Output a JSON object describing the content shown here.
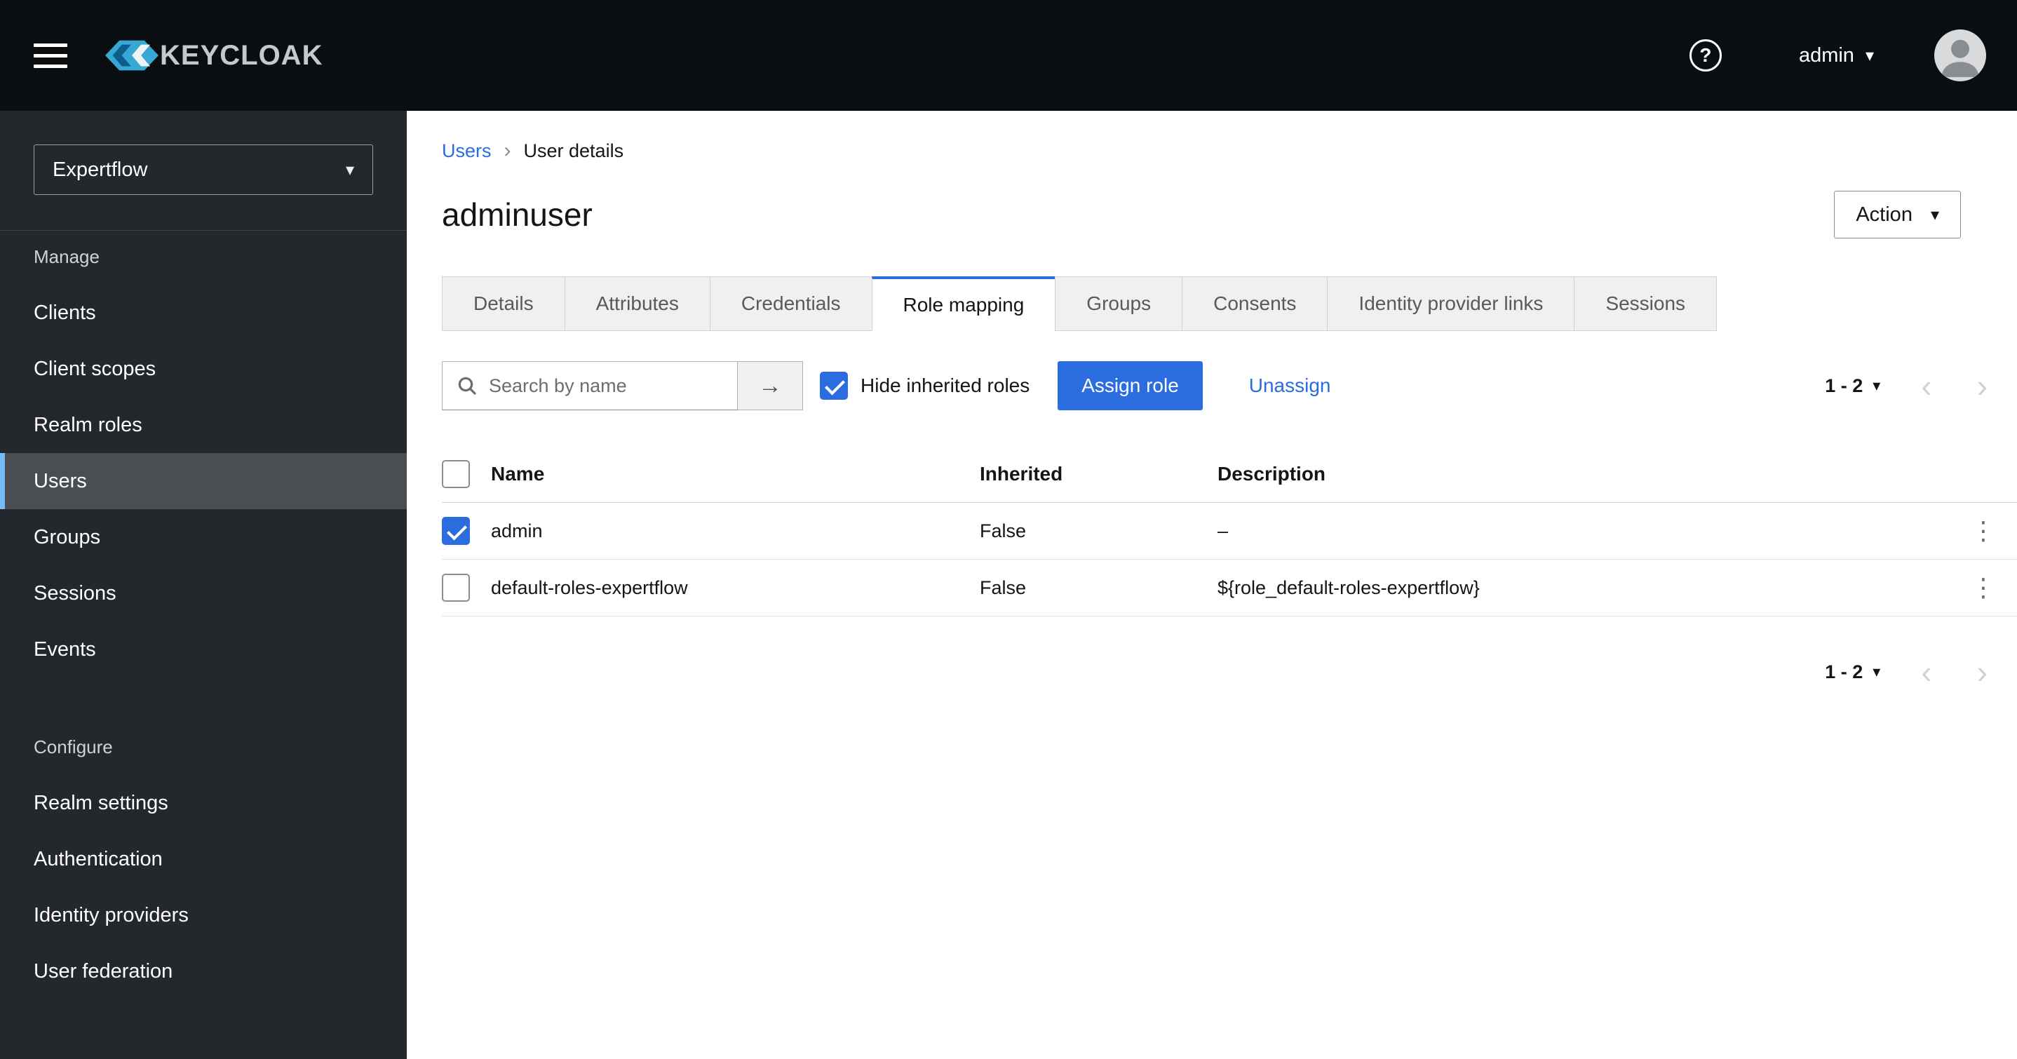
{
  "colors": {
    "primary_blue": "#2b6cde",
    "masthead_bg": "#0b0e10",
    "sidebar_bg": "#24282c",
    "nav_selected_accent": "#73bcf7",
    "inactive_tab_bg": "#f0f0f0"
  },
  "icons": {
    "help": "?",
    "caret_down": "▾",
    "kebab": "⋮",
    "prev_chevron": "‹",
    "next_chevron": "›",
    "breadcrumb_separator": "›",
    "search_arrow": "→"
  },
  "masthead": {
    "brand": "KEYCLOAK",
    "user_label": "admin"
  },
  "sidebar": {
    "realm_selector": "Expertflow",
    "selected_item": "Users",
    "sections": [
      {
        "title": "Manage",
        "items": [
          "Clients",
          "Client scopes",
          "Realm roles",
          "Users",
          "Groups",
          "Sessions",
          "Events"
        ]
      },
      {
        "title": "Configure",
        "items": [
          "Realm settings",
          "Authentication",
          "Identity providers",
          "User federation"
        ]
      }
    ]
  },
  "breadcrumb": {
    "items": [
      "Users",
      "User details"
    ]
  },
  "page": {
    "title": "adminuser",
    "action_label": "Action"
  },
  "tabs": {
    "active": "Role mapping",
    "items": [
      "Details",
      "Attributes",
      "Credentials",
      "Role mapping",
      "Groups",
      "Consents",
      "Identity provider links",
      "Sessions"
    ]
  },
  "toolbar": {
    "search_placeholder": "Search by name",
    "hide_inherited_label": "Hide inherited roles",
    "hide_inherited_checked": true,
    "assign_button": "Assign role",
    "unassign_link": "Unassign",
    "pagination_range": "1 - 2"
  },
  "table": {
    "header_checkbox_checked": false,
    "columns": [
      "Name",
      "Inherited",
      "Description"
    ],
    "rows": [
      {
        "checked": true,
        "name": "admin",
        "inherited": "False",
        "description": "–"
      },
      {
        "checked": false,
        "name": "default-roles-expertflow",
        "inherited": "False",
        "description": "${role_default-roles-expertflow}"
      }
    ]
  }
}
